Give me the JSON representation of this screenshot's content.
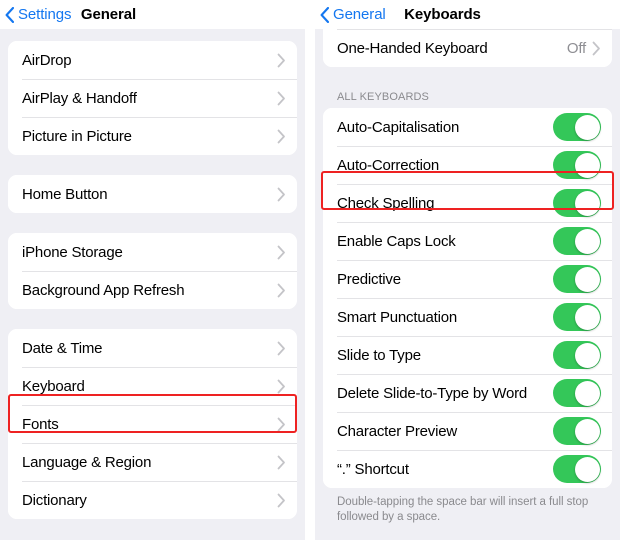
{
  "colors": {
    "accent_blue": "#1477f0",
    "toggle_on_green": "#34c759",
    "highlight_red": "#ee2222",
    "background_gray": "#efeff4",
    "secondary_text": "#8e8e93"
  },
  "left_panel": {
    "nav": {
      "back_label": "Settings",
      "title": "General"
    },
    "groups": [
      {
        "rows": [
          {
            "label": "AirDrop",
            "type": "disclosure"
          },
          {
            "label": "AirPlay & Handoff",
            "type": "disclosure"
          },
          {
            "label": "Picture in Picture",
            "type": "disclosure"
          }
        ]
      },
      {
        "rows": [
          {
            "label": "Home Button",
            "type": "disclosure"
          }
        ]
      },
      {
        "rows": [
          {
            "label": "iPhone Storage",
            "type": "disclosure"
          },
          {
            "label": "Background App Refresh",
            "type": "disclosure"
          }
        ]
      },
      {
        "rows": [
          {
            "label": "Date & Time",
            "type": "disclosure"
          },
          {
            "label": "Keyboard",
            "type": "disclosure",
            "highlighted": true
          },
          {
            "label": "Fonts",
            "type": "disclosure"
          },
          {
            "label": "Language & Region",
            "type": "disclosure"
          },
          {
            "label": "Dictionary",
            "type": "disclosure"
          }
        ]
      }
    ]
  },
  "right_panel": {
    "nav": {
      "back_label": "General",
      "title": "Keyboards"
    },
    "top_group": {
      "rows": [
        {
          "label": "One-Handed Keyboard",
          "type": "value",
          "value": "Off"
        }
      ]
    },
    "section_header": "ALL KEYBOARDS",
    "toggle_rows": [
      {
        "label": "Auto-Capitalisation",
        "on": true
      },
      {
        "label": "Auto-Correction",
        "on": true,
        "highlighted": true
      },
      {
        "label": "Check Spelling",
        "on": true
      },
      {
        "label": "Enable Caps Lock",
        "on": true
      },
      {
        "label": "Predictive",
        "on": true
      },
      {
        "label": "Smart Punctuation",
        "on": true
      },
      {
        "label": "Slide to Type",
        "on": true
      },
      {
        "label": "Delete Slide-to-Type by Word",
        "on": true
      },
      {
        "label": "Character Preview",
        "on": true
      },
      {
        "label": "“.” Shortcut",
        "on": true
      }
    ],
    "footnote": "Double-tapping the space bar will insert a full stop followed by a space."
  }
}
